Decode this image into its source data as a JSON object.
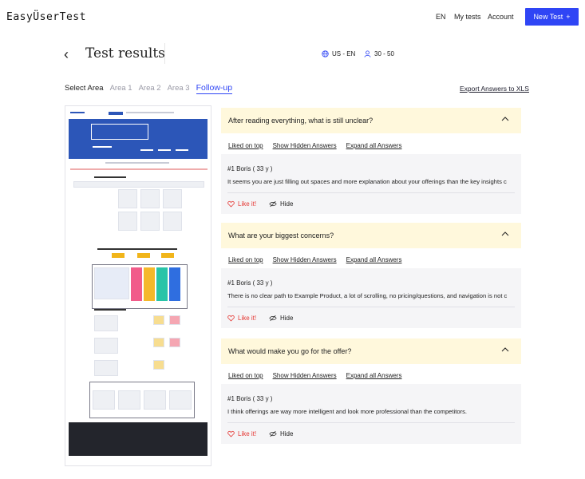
{
  "header": {
    "logo": "EasyÜserTest",
    "nav": {
      "lang": "EN",
      "my_tests": "My tests",
      "account": "Account"
    },
    "new_test": {
      "label": "New Test",
      "icon": "plus-icon"
    }
  },
  "page": {
    "title": "Test results",
    "locale": "US - EN",
    "age_range": "30 - 50"
  },
  "tabs": {
    "label": "Select Area",
    "items": [
      "Area 1",
      "Area 2",
      "Area 3",
      "Follow-up"
    ],
    "active": "Follow-up"
  },
  "export_label": "Export Answers to XLS",
  "question_links": {
    "liked_on_top": "Liked on top",
    "show_hidden": "Show Hidden Answers",
    "expand_all": "Expand all Answers"
  },
  "questions": [
    {
      "title": "After reading everything, what is still unclear?",
      "answer": {
        "who": "#1 Boris ( 33 y )",
        "text": "It seems you are just filling out spaces and more explanation about your offerings than the key insights c",
        "like": "Like it!",
        "hide": "Hide"
      }
    },
    {
      "title": "What are your biggest concerns?",
      "answer": {
        "who": "#1 Boris ( 33 y )",
        "text": "There is no clear path to Example Product, a lot of scrolling, no pricing/questions, and navigation is not c",
        "like": "Like it!",
        "hide": "Hide"
      }
    },
    {
      "title": "What would make you go for the offer?",
      "answer": {
        "who": "#1 Boris ( 33 y )",
        "text": "I think offerings are way more intelligent and look more professional than the competitors.",
        "like": "Like it!",
        "hide": "Hide"
      }
    }
  ],
  "colors": {
    "accent": "#2f45f5",
    "question_bg": "#fff8dc",
    "answer_bg": "#f5f5f7",
    "like": "#e53935"
  }
}
